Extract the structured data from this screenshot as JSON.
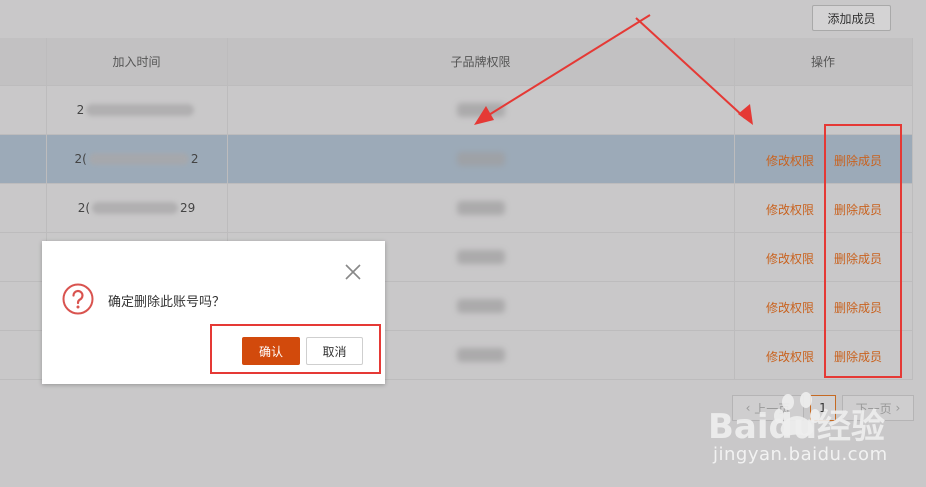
{
  "toolbar": {
    "add_member_label": "添加成员"
  },
  "table": {
    "headers": {
      "join_time": "加入时间",
      "brand_perm": "子品牌权限",
      "actions": "操作"
    },
    "rows": [
      {
        "date_start": "2",
        "date_end": "",
        "selected": false,
        "edit": "",
        "delete": ""
      },
      {
        "date_start": "2(",
        "date_end": "2",
        "selected": true,
        "edit": "修改权限",
        "delete": "删除成员"
      },
      {
        "date_start": "2(",
        "date_end": "29",
        "selected": false,
        "edit": "修改权限",
        "delete": "删除成员"
      },
      {
        "date_start": "",
        "date_end": "",
        "selected": false,
        "edit": "修改权限",
        "delete": "删除成员"
      },
      {
        "date_start": "",
        "date_end": "",
        "selected": false,
        "edit": "修改权限",
        "delete": "删除成员"
      },
      {
        "date_start": "",
        "date_end": "",
        "selected": false,
        "edit": "修改权限",
        "delete": "删除成员"
      }
    ]
  },
  "pagination": {
    "prev": "上一页",
    "current": "1",
    "next": "下一页"
  },
  "dialog": {
    "message": "确定删除此账号吗？",
    "confirm": "确认",
    "cancel": "取消",
    "icons": {
      "question": "question-icon",
      "close": "close-icon"
    }
  },
  "watermark": {
    "brand": "Baidu经验",
    "url": "jingyan.baidu.com"
  },
  "colors": {
    "link": "#c9621e",
    "primary_button": "#d24a0c",
    "annotation": "#e53935",
    "selected_row": "#9caab8"
  }
}
